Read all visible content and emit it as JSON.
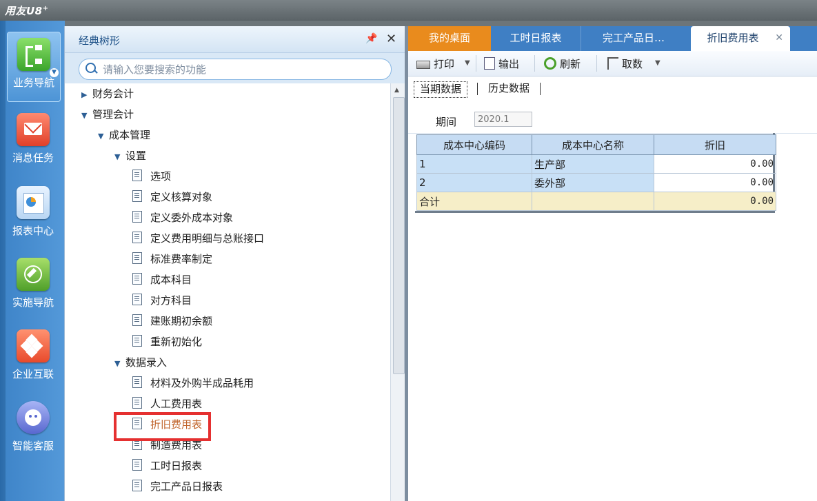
{
  "app": {
    "logo": "用友U8",
    "logo_sup": "+"
  },
  "rail": {
    "items": [
      {
        "label": "业务导航",
        "icon": "business-nav-icon",
        "active": true
      },
      {
        "label": "消息任务",
        "icon": "message-icon"
      },
      {
        "label": "报表中心",
        "icon": "report-icon"
      },
      {
        "label": "实施导航",
        "icon": "compass-icon"
      },
      {
        "label": "企业互联",
        "icon": "connect-icon"
      },
      {
        "label": "智能客服",
        "icon": "service-icon"
      }
    ]
  },
  "tree": {
    "title": "经典树形",
    "search_placeholder": "请输入您要搜索的功能",
    "nodes": [
      {
        "label": "财务会计",
        "level": 0,
        "type": "collapsed"
      },
      {
        "label": "管理会计",
        "level": 0,
        "type": "expanded"
      },
      {
        "label": "成本管理",
        "level": 1,
        "type": "expanded"
      },
      {
        "label": "设置",
        "level": 2,
        "type": "expanded"
      },
      {
        "label": "选项",
        "level": 3,
        "type": "doc"
      },
      {
        "label": "定义核算对象",
        "level": 3,
        "type": "doc"
      },
      {
        "label": "定义委外成本对象",
        "level": 3,
        "type": "doc"
      },
      {
        "label": "定义费用明细与总账接口",
        "level": 3,
        "type": "doc"
      },
      {
        "label": "标准费率制定",
        "level": 3,
        "type": "doc"
      },
      {
        "label": "成本科目",
        "level": 3,
        "type": "doc"
      },
      {
        "label": "对方科目",
        "level": 3,
        "type": "doc"
      },
      {
        "label": "建账期初余额",
        "level": 3,
        "type": "doc"
      },
      {
        "label": "重新初始化",
        "level": 3,
        "type": "doc"
      },
      {
        "label": "数据录入",
        "level": 2,
        "type": "expanded"
      },
      {
        "label": "材料及外购半成品耗用",
        "level": 3,
        "type": "doc"
      },
      {
        "label": "人工费用表",
        "level": 3,
        "type": "doc"
      },
      {
        "label": "折旧费用表",
        "level": 3,
        "type": "doc",
        "selected": true
      },
      {
        "label": "制造费用表",
        "level": 3,
        "type": "doc"
      },
      {
        "label": "工时日报表",
        "level": 3,
        "type": "doc"
      },
      {
        "label": "完工产品日报表",
        "level": 3,
        "type": "doc"
      }
    ]
  },
  "tabs": [
    {
      "label": "我的桌面"
    },
    {
      "label": "工时日报表"
    },
    {
      "label": "完工产品日…"
    },
    {
      "label": "折旧费用表",
      "active": true
    }
  ],
  "toolbar": {
    "print": "打印",
    "export": "输出",
    "refresh": "刷新",
    "fetch": "取数"
  },
  "subtabs": {
    "current": "当期数据",
    "history": "历史数据"
  },
  "period": {
    "label": "期间",
    "value": "2020.1"
  },
  "grid": {
    "headers": [
      "成本中心编码",
      "成本中心名称",
      "折旧"
    ],
    "rows": [
      {
        "code": "1",
        "name": "生产部",
        "value": "0.00"
      },
      {
        "code": "2",
        "name": "委外部",
        "value": "0.00"
      }
    ],
    "total": {
      "label": "合计",
      "value": "0.00"
    }
  },
  "colors": {
    "accent": "#3f7fc4",
    "home_tab": "#e98b1d",
    "highlight": "#e53030",
    "selected_text": "#c0632a"
  }
}
